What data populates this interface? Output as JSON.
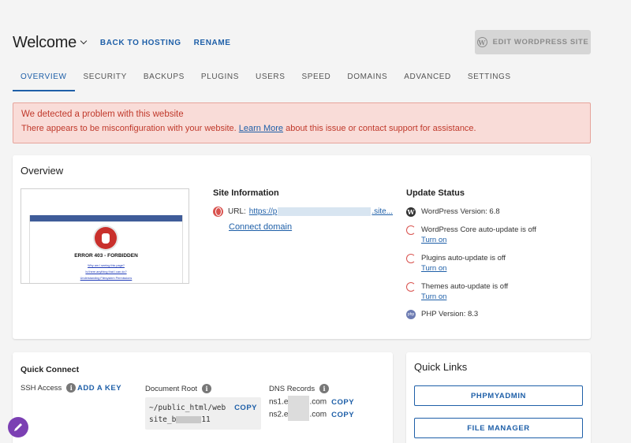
{
  "header": {
    "site_title": "Welcome",
    "back_link": "BACK TO HOSTING",
    "rename_link": "RENAME",
    "edit_button": "EDIT WORDPRESS SITE"
  },
  "tabs": [
    {
      "label": "OVERVIEW",
      "active": true
    },
    {
      "label": "SECURITY"
    },
    {
      "label": "BACKUPS"
    },
    {
      "label": "PLUGINS"
    },
    {
      "label": "USERS"
    },
    {
      "label": "SPEED"
    },
    {
      "label": "DOMAINS"
    },
    {
      "label": "ADVANCED"
    },
    {
      "label": "SETTINGS"
    }
  ],
  "alert": {
    "title": "We detected a problem with this website",
    "text_before": "There appears to be misconfiguration with your website. ",
    "link": "Learn More",
    "text_after": " about this issue or contact support for assistance."
  },
  "overview": {
    "title": "Overview",
    "thumbnail": {
      "error_title": "ERROR 403 - FORBIDDEN",
      "links": [
        "Why am I seeing this page?",
        "Is there anything that I can do?",
        "Understanding Filesystem Permissions"
      ]
    },
    "site_info": {
      "title": "Site Information",
      "url_label": "URL:",
      "url_start": "https://p",
      "url_end": ".site...",
      "connect_domain": "Connect domain"
    },
    "update_status": {
      "title": "Update Status",
      "wp_version": "WordPress Version: 6.8",
      "core": "WordPress Core auto-update is off",
      "plugins": "Plugins auto-update is off",
      "themes": "Themes auto-update is off",
      "turn_on": "Turn on",
      "php_version": "PHP Version: 8.3"
    }
  },
  "quick_connect": {
    "title": "Quick Connect",
    "ssh_label": "SSH Access",
    "add_key": "ADD A KEY",
    "doc_root_label": "Document Root",
    "doc_root_line1": "~/public_html/web",
    "doc_root_line2_start": "site_b",
    "doc_root_line2_end": "11",
    "dns_label": "DNS Records",
    "ns1_start": "ns1.e",
    "ns2_start": "ns2.e",
    "ns_end": ".com",
    "copy": "COPY"
  },
  "quick_links": {
    "title": "Quick Links",
    "buttons": [
      "PHPMYADMIN",
      "FILE MANAGER"
    ]
  },
  "colors": {
    "accent": "#1e5fa8",
    "alert_bg": "#f9dcd8",
    "alert_text": "#c0392b",
    "fab": "#7b3fb3"
  }
}
